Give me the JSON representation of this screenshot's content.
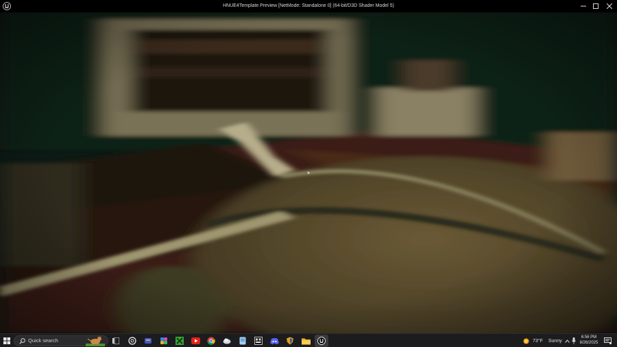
{
  "window": {
    "title": "HNUE4Template Preview [NetMode: Standalone 0]  (64-bit/D3D Shader Model 5)",
    "app_icon": "unreal-engine-icon"
  },
  "taskbar": {
    "search_label": "Quick search",
    "weather_temp": "73°F",
    "weather_desc": "Sunny",
    "time": "6:56 PM",
    "date": "8/26/2025",
    "apps": [
      "task-view-icon",
      "chatgpt-icon",
      "edge-sync-icon",
      "copilot-icon",
      "minecraft-icon",
      "youtube-icon",
      "chrome-icon",
      "app-icon",
      "cloud-app-icon",
      "terminal-icon",
      "discord-icon",
      "vpn-shield-icon",
      "file-explorer-icon",
      "unreal-engine-icon"
    ]
  }
}
